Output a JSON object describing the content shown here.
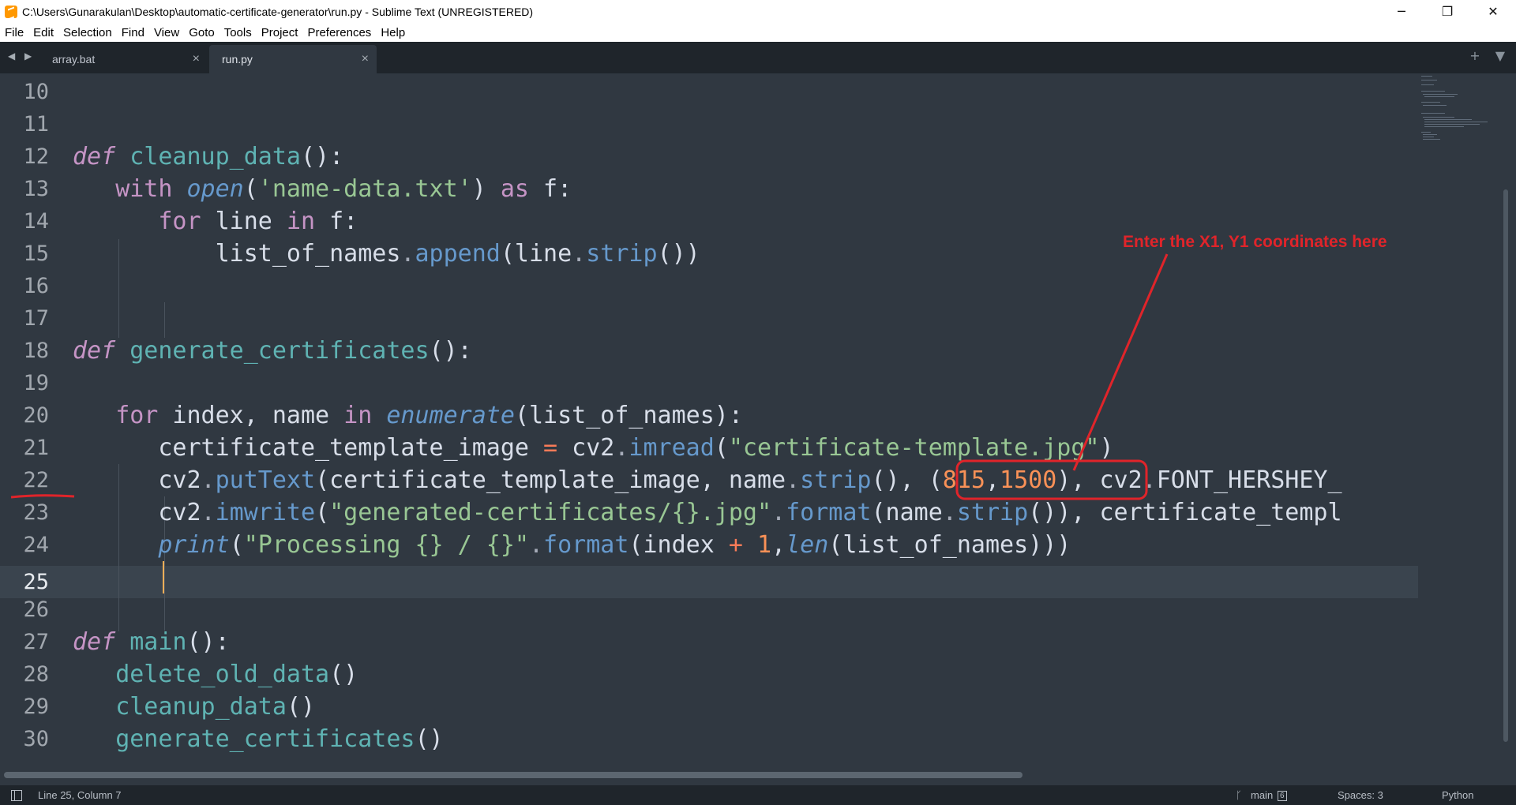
{
  "window": {
    "title": "C:\\Users\\Gunarakulan\\Desktop\\automatic-certificate-generator\\run.py - Sublime Text (UNREGISTERED)",
    "minimize": "─",
    "restore": "❐",
    "close": "✕"
  },
  "menu": [
    "File",
    "Edit",
    "Selection",
    "Find",
    "View",
    "Goto",
    "Tools",
    "Project",
    "Preferences",
    "Help"
  ],
  "tabs": [
    {
      "label": "array.bat",
      "close": "×",
      "active": false
    },
    {
      "label": "run.py",
      "close": "×",
      "active": true
    }
  ],
  "tab_nav": "◀ ▶",
  "tab_right": {
    "add": "+",
    "menu": "▼"
  },
  "line_numbers": [
    "10",
    "11",
    "12",
    "13",
    "14",
    "15",
    "16",
    "17",
    "18",
    "19",
    "20",
    "21",
    "22",
    "23",
    "24",
    "25",
    "26",
    "27",
    "28",
    "29",
    "30"
  ],
  "current_line": "25",
  "annotation": {
    "text": "Enter the X1, Y1 coordinates here",
    "color": "#e0242a"
  },
  "status": {
    "position": "Line 25, Column 7",
    "branch": "main",
    "branch_count": "6",
    "spaces": "Spaces: 3",
    "syntax": "Python"
  },
  "colors": {
    "background": "#303841",
    "keyword": "#c594c5",
    "function": "#5fb3b3",
    "string": "#99c794",
    "number": "#f99157",
    "method": "#6699cc"
  }
}
